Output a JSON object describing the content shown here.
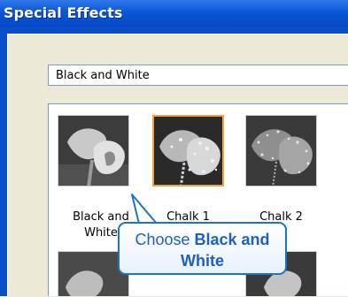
{
  "window": {
    "title": "Special Effects"
  },
  "effect_dropdown": {
    "value": "Black and White"
  },
  "effects": [
    {
      "label_line1": "Black and",
      "label_line2": "White",
      "icon": "calla-lily-bw"
    },
    {
      "label_line1": "Chalk 1",
      "label_line2": "",
      "icon": "calla-lily-chalk",
      "selected": true
    },
    {
      "label_line1": "Chalk 2",
      "label_line2": "",
      "icon": "calla-lily-chalk-2"
    }
  ],
  "callout": {
    "text_plain": "Choose ",
    "text_bold": "Black and White"
  },
  "colors": {
    "titlebar": "#0a56d9",
    "selection": "#f0a640",
    "callout_border": "#1e73c8",
    "callout_text": "#1d5fc4"
  }
}
